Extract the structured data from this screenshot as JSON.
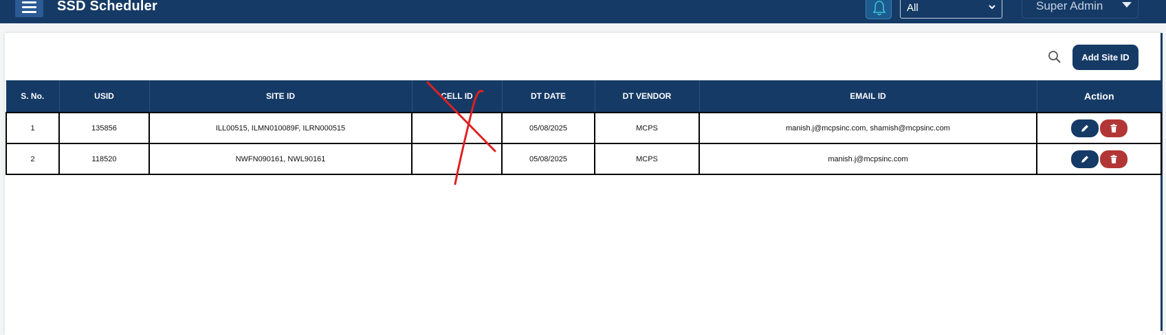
{
  "header": {
    "title": "SSD Scheduler",
    "menu_icon": "hamburger-menu-icon",
    "bell_icon": "bell-icon",
    "filter": {
      "selected": "All"
    },
    "user": {
      "name": "Super Admin"
    }
  },
  "toolbar": {
    "search_icon": "search-icon",
    "add_label": "Add Site ID"
  },
  "table": {
    "columns": [
      "S. No.",
      "USID",
      "SITE ID",
      "CELL ID",
      "DT DATE",
      "DT VENDOR",
      "EMAIL ID",
      "Action"
    ],
    "rows": [
      {
        "sno": "1",
        "usid": "135856",
        "site_id": "ILL00515, ILMN010089F, ILRN000515",
        "cell_id": "",
        "dt_date": "05/08/2025",
        "dt_vendor": "MCPS",
        "email": "manish.j@mcpsinc.com, shamish@mcpsinc.com"
      },
      {
        "sno": "2",
        "usid": "118520",
        "site_id": "NWFN090161, NWL90161",
        "cell_id": "",
        "dt_date": "05/08/2025",
        "dt_vendor": "MCPS",
        "email": "manish.j@mcpsinc.com"
      }
    ]
  },
  "colors": {
    "primary": "#153a66",
    "danger": "#b33636",
    "annotation": "#e02020"
  }
}
